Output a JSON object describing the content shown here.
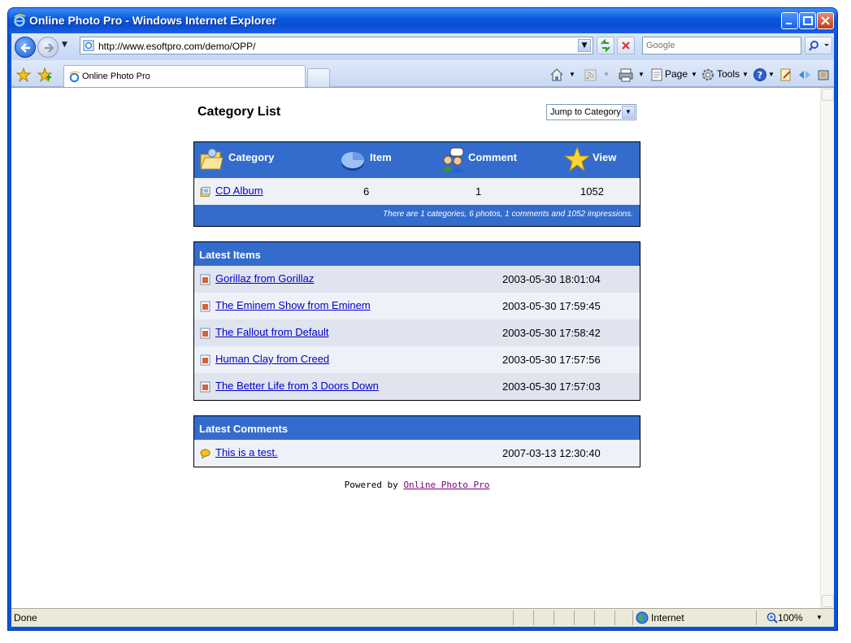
{
  "window": {
    "title": "Online Photo Pro - Windows Internet Explorer"
  },
  "address": {
    "url": "http://www.esoftpro.com/demo/OPP/"
  },
  "search": {
    "placeholder": "Google"
  },
  "tab": {
    "label": "Online Photo Pro"
  },
  "commands": {
    "page": "Page",
    "tools": "Tools"
  },
  "page": {
    "title": "Category List",
    "jump_label": "Jump to Category",
    "category_table": {
      "headers": [
        "Category",
        "Item",
        "Comment",
        "View"
      ],
      "rows": [
        {
          "name": "CD Album",
          "items": "6",
          "comments": "1",
          "views": "1052"
        }
      ],
      "summary": "There are 1 categories, 6 photos, 1 comments and 1052 impressions."
    },
    "latest_items": {
      "title": "Latest Items",
      "rows": [
        {
          "name": "Gorillaz from Gorillaz",
          "date": "2003-05-30 18:01:04"
        },
        {
          "name": "The Eminem Show from Eminem",
          "date": "2003-05-30 17:59:45"
        },
        {
          "name": "The Fallout from Default",
          "date": "2003-05-30 17:58:42"
        },
        {
          "name": "Human Clay from Creed",
          "date": "2003-05-30 17:57:56"
        },
        {
          "name": "The Better Life from 3 Doors Down",
          "date": "2003-05-30 17:57:03"
        }
      ]
    },
    "latest_comments": {
      "title": "Latest Comments",
      "rows": [
        {
          "name": "This is a test.",
          "date": "2007-03-13 12:30:40"
        }
      ]
    },
    "powered_prefix": "Powered by",
    "powered_link": "Online Photo Pro"
  },
  "status": {
    "text": "Done",
    "zone": "Internet",
    "zoom": "100%"
  }
}
